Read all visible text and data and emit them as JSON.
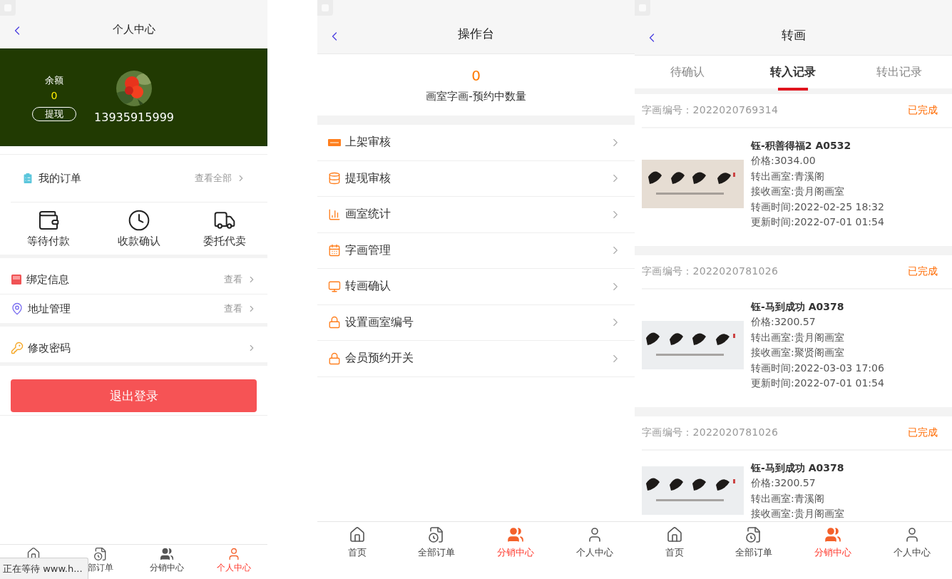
{
  "screens": [
    {
      "kind": "profile",
      "title": "个人中心",
      "balance_label": "余额",
      "balance": "0",
      "withdraw": "提现",
      "phone": "13935915999",
      "orders": {
        "title": "我的订单",
        "link": "查看全部",
        "shortcuts": [
          {
            "label": "等待付款"
          },
          {
            "label": "收款确认"
          },
          {
            "label": "委托代卖"
          }
        ]
      },
      "menu_groups": [
        [
          {
            "label": "绑定信息",
            "action": "查看"
          },
          {
            "label": "地址管理",
            "action": "查看"
          }
        ],
        [
          {
            "label": "修改密码"
          }
        ]
      ],
      "logout": "退出登录",
      "tabs": [
        {
          "selected": false
        },
        {
          "label": "部订单",
          "selected": false
        },
        {
          "label": "分销中心",
          "selected": false
        },
        {
          "label": "个人中心",
          "selected": true
        }
      ],
      "status_text": "正在等待 www.h..."
    },
    {
      "kind": "console",
      "title": "操作台",
      "count": "0",
      "count_label": "画室字画-预约中数量",
      "menu": [
        {
          "label": "上架审核"
        },
        {
          "label": "提现审核"
        },
        {
          "label": "画室统计"
        },
        {
          "label": "字画管理"
        },
        {
          "label": "转画确认"
        },
        {
          "label": "设置画室编号"
        },
        {
          "label": "会员预约开关"
        }
      ],
      "tabs": [
        {
          "label": "首页",
          "selected": false
        },
        {
          "label": "全部订单",
          "selected": false
        },
        {
          "label": "分销中心",
          "selected": true
        },
        {
          "label": "个人中心",
          "selected": false
        }
      ]
    },
    {
      "kind": "transfer",
      "title": "转画",
      "record_tabs": [
        {
          "label": "待确认",
          "selected": false
        },
        {
          "label": "转入记录",
          "selected": true
        },
        {
          "label": "转出记录",
          "selected": false
        }
      ],
      "records": [
        {
          "code": "字画编号：2022020769314",
          "status": "已完成",
          "name": "钰-积善得福2 A0532",
          "lines": [
            "价格:3034.00",
            "转出画室:青溪阁",
            "接收画室:贵月阁画室",
            "转画时间:2022-02-25 18:32",
            "更新时间:2022-07-01 01:54"
          ]
        },
        {
          "code": "字画编号：2022020781026",
          "status": "已完成",
          "name": "钰-马到成功 A0378",
          "lines": [
            "价格:3200.57",
            "转出画室:贵月阁画室",
            "接收画室:聚贤阁画室",
            "转画时间:2022-03-03 17:06",
            "更新时间:2022-07-01 01:54"
          ]
        },
        {
          "code": "字画编号：2022020781026",
          "status": "已完成",
          "name": "钰-马到成功 A0378",
          "lines": [
            "价格:3200.57",
            "转出画室:青溪阁",
            "接收画室:贵月阁画室"
          ]
        }
      ],
      "tabs": [
        {
          "label": "首页",
          "selected": false
        },
        {
          "label": "全部订单",
          "selected": false
        },
        {
          "label": "分销中心",
          "selected": true
        },
        {
          "label": "个人中心",
          "selected": false
        }
      ]
    }
  ]
}
